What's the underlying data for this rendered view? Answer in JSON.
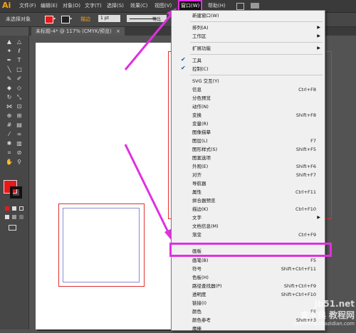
{
  "app": {
    "logo": "Ai",
    "brand_color": "#f7a11a"
  },
  "menubar": {
    "items": [
      "文件(F)",
      "编辑(E)",
      "对象(O)",
      "文字(T)",
      "选择(S)",
      "效果(C)",
      "视图(V)",
      "窗口(W)",
      "帮助(H)"
    ]
  },
  "control_bar": {
    "selection_status": "未选择对象",
    "stroke_weight": "1 pt",
    "stroke_label": "描边",
    "uniform_label": "等比"
  },
  "document_tab": {
    "title": "未标题-4* @ 117% (CMYK/预览)",
    "close": "×"
  },
  "window_menu": {
    "items": [
      {
        "label": "新建窗口(W)"
      },
      {
        "label": "排列(A)",
        "submenu": true
      },
      {
        "label": "工作区",
        "submenu": true
      },
      {
        "label": "扩展功能",
        "submenu": true
      },
      {
        "label": "工具",
        "checked": true
      },
      {
        "label": "控制(C)",
        "checked": true
      },
      {
        "label": "SVG 交互(Y)"
      },
      {
        "label": "信息",
        "shortcut": "Ctrl+F8"
      },
      {
        "label": "分色预览"
      },
      {
        "label": "动作(N)"
      },
      {
        "label": "变换",
        "shortcut": "Shift+F8"
      },
      {
        "label": "变量(R)"
      },
      {
        "label": "图像描摹"
      },
      {
        "label": "图层(L)",
        "shortcut": "F7"
      },
      {
        "label": "图形样式(S)",
        "shortcut": "Shift+F5"
      },
      {
        "label": "图案选项"
      },
      {
        "label": "外观(E)",
        "shortcut": "Shift+F6"
      },
      {
        "label": "对齐",
        "shortcut": "Shift+F7"
      },
      {
        "label": "导航器"
      },
      {
        "label": "属性",
        "shortcut": "Ctrl+F11"
      },
      {
        "label": "拼合器预览"
      },
      {
        "label": "描边(K)",
        "shortcut": "Ctrl+F10"
      },
      {
        "label": "文字",
        "submenu": true
      },
      {
        "label": "文档信息(M)"
      },
      {
        "label": "渐变",
        "shortcut": "Ctrl+F9"
      },
      {
        "label": "画板"
      },
      {
        "label": "画笔(B)",
        "shortcut": "F5"
      },
      {
        "label": "符号",
        "shortcut": "Shift+Ctrl+F11"
      },
      {
        "label": "色板(H)"
      },
      {
        "label": "路径查找器(P)",
        "shortcut": "Shift+Ctrl+F9"
      },
      {
        "label": "透明度",
        "shortcut": "Shift+Ctrl+F10"
      },
      {
        "label": "链接(I)"
      },
      {
        "label": "颜色",
        "shortcut": "F6"
      },
      {
        "label": "颜色参考",
        "shortcut": "Shift+F3"
      },
      {
        "label": "魔棒"
      }
    ]
  },
  "watermark": {
    "line1": "jb51.net",
    "line2": "查字典 教程网",
    "line3": "jiaocheng.chazidian.com"
  },
  "colors": {
    "highlight": "#e030e0",
    "fill_swatch": "#e8191a",
    "menu_bg": "#f0f0f0"
  }
}
